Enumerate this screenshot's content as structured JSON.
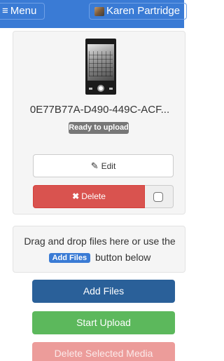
{
  "topbar": {
    "menu_label": "Menu",
    "menu_icon": "hamburger-icon",
    "user_name": "Karen Partridge"
  },
  "media_item": {
    "filename": "0E77B77A-D490-449C-ACF...",
    "status": "Ready to upload",
    "edit_label": "Edit",
    "delete_label": "Delete",
    "selected": false
  },
  "dropzone": {
    "line1": "Drag and drop files here or use the",
    "inline_button": "Add Files",
    "line2_suffix": "button below"
  },
  "actions": {
    "add_files": "Add Files",
    "start_upload": "Start Upload",
    "delete_selected": "Delete Selected Media"
  },
  "colors": {
    "primary": "#3a7bd5",
    "add_files": "#2a6099",
    "success": "#5cb85c",
    "danger": "#d9534f",
    "danger_disabled": "#ec9c9a"
  }
}
